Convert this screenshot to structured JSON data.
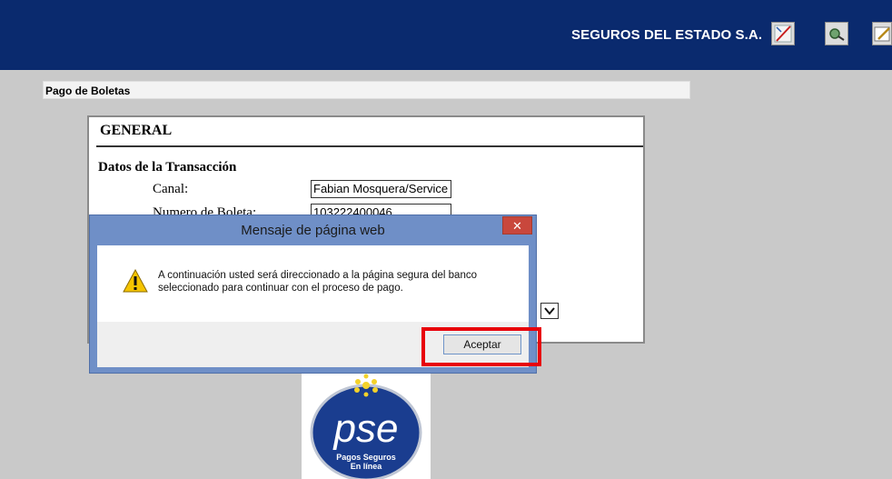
{
  "header": {
    "brand": "SEGUROS DEL ESTADO S.A.",
    "icons": [
      "close-form-icon",
      "search-icon",
      "edit-icon"
    ]
  },
  "breadcrumb": "Pago de Boletas",
  "form": {
    "section_title": "GENERAL",
    "subsection_title": "Datos de la Transacción",
    "fields": [
      {
        "label": "Canal:",
        "value": "Fabian Mosquera/Service"
      },
      {
        "label": "Numero de Boleta:",
        "value": "103222400046"
      }
    ]
  },
  "dialog": {
    "title": "Mensaje de página web",
    "close_glyph": "✕",
    "message_line1": "A continuación usted será direccionado a la página segura del banco",
    "message_line2": "seleccionado para continuar con el proceso de pago.",
    "ok_label": "Aceptar"
  },
  "pse": {
    "logo_text": "pse",
    "tagline_line1": "Pagos Seguros",
    "tagline_line2": "En línea"
  },
  "colors": {
    "header_bg": "#0a2a6e",
    "dialog_frame": "#6f8fc7",
    "highlight": "#e8000b",
    "pse_blue": "#1a3d8f"
  }
}
